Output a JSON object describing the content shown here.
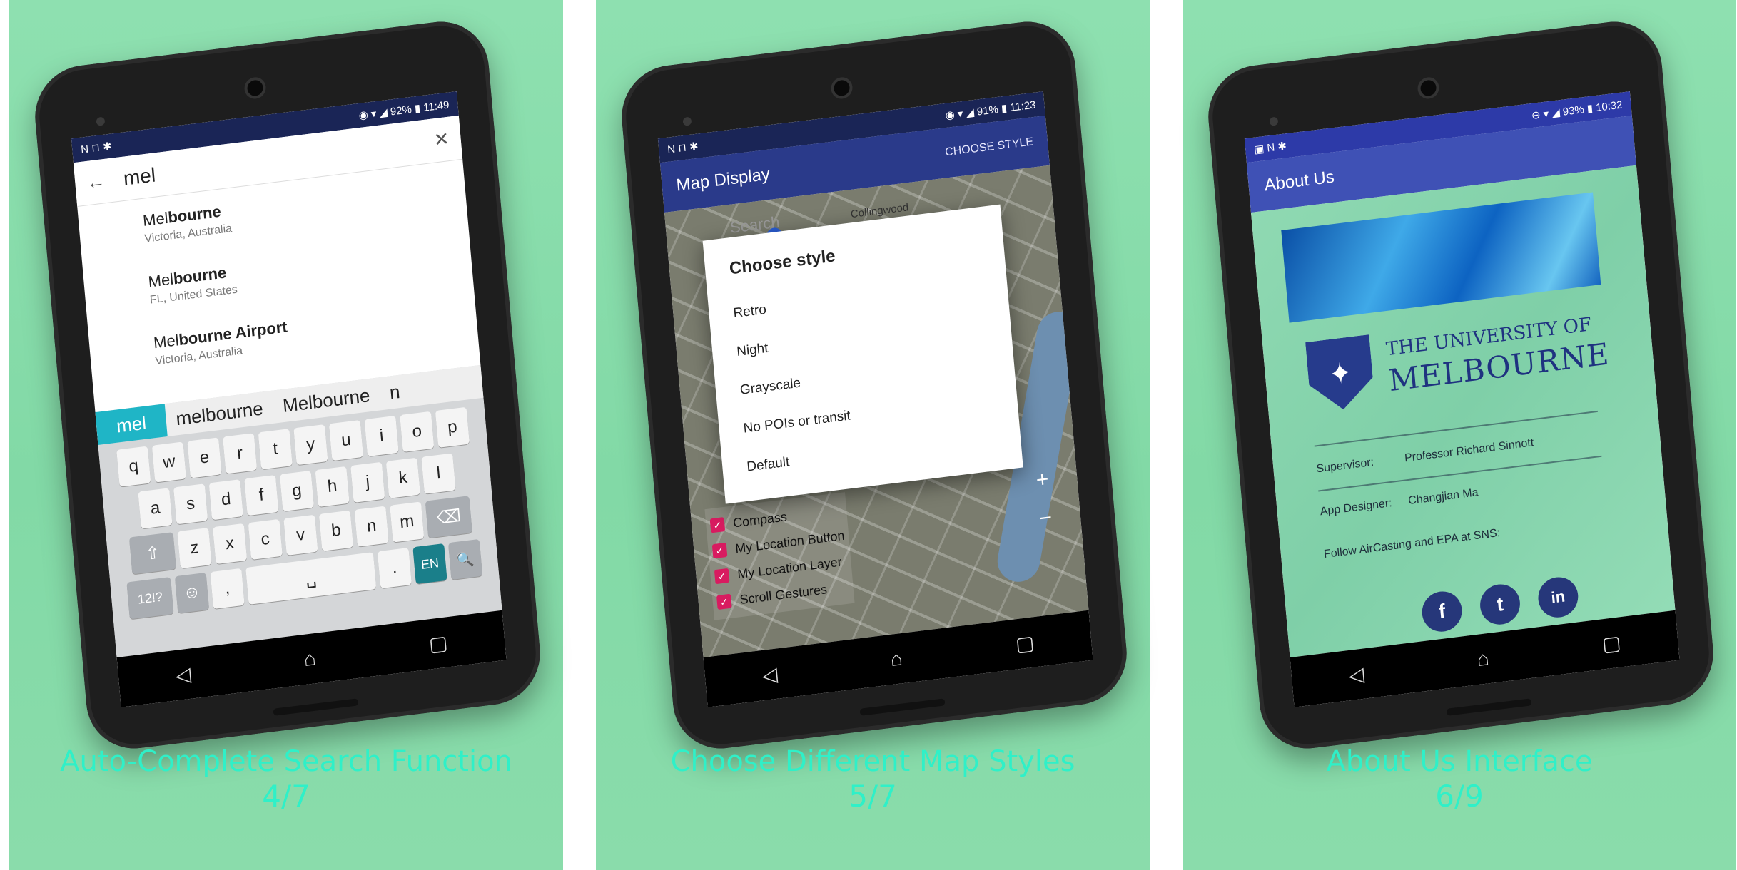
{
  "panels": [
    {
      "caption": "Auto-Complete Search Function",
      "page": "4/7",
      "status": {
        "left": "N ⊓ ✱",
        "right": "◉ ▾ ◢ 92% ▮ 11:49"
      },
      "search": {
        "query": "mel",
        "back_icon": "arrow-left-icon",
        "clear_icon": "close-icon"
      },
      "suggestions": [
        {
          "match": "Mel",
          "rest": "bourne",
          "sub": "Victoria, Australia"
        },
        {
          "match": "Mel",
          "rest": "bourne",
          "sub": "FL, United States"
        },
        {
          "match": "Mel",
          "rest": "bourne Airport",
          "sub": "Victoria, Australia"
        }
      ],
      "keyboard": {
        "predictions": [
          "mel",
          "melbourne",
          "Melbourne",
          "n"
        ],
        "row1": [
          "q",
          "w",
          "e",
          "r",
          "t",
          "y",
          "u",
          "i",
          "o",
          "p"
        ],
        "row2": [
          "a",
          "s",
          "d",
          "f",
          "g",
          "h",
          "j",
          "k",
          "l"
        ],
        "row3": [
          "⇧",
          "z",
          "x",
          "c",
          "v",
          "b",
          "n",
          "m",
          "⌫"
        ],
        "row4": [
          "12!?",
          "☺",
          ",",
          "␣",
          ".",
          "EN",
          "🔍"
        ]
      }
    },
    {
      "caption": "Choose Different Map Styles",
      "page": "5/7",
      "status": {
        "left": "N ⊓ ✱",
        "right": "◉ ▾ ◢ 91% ▮ 11:23"
      },
      "appbar": {
        "title": "Map Display",
        "action": "CHOOSE STYLE"
      },
      "map": {
        "search_placeholder": "Search",
        "place": "Collingwood"
      },
      "dialog": {
        "title": "Choose style",
        "options": [
          "Retro",
          "Night",
          "Grayscale",
          "No POIs or transit",
          "Default"
        ]
      },
      "checks": [
        "Compass",
        "My Location Button",
        "My Location Layer",
        "Scroll Gestures"
      ]
    },
    {
      "caption": "About Us Interface",
      "page": "6/9",
      "status": {
        "left": "▣ N ✱",
        "right": "⊖ ▾ ◢ 93% ▮ 10:32"
      },
      "appbar": {
        "title": "About Us"
      },
      "university": {
        "line1": "THE UNIVERSITY OF",
        "line2": "MELBOURNE"
      },
      "info": [
        {
          "key": "Supervisor:",
          "value": "Professor Richard Sinnott"
        },
        {
          "key": "App Designer:",
          "value": "Changjian Ma"
        }
      ],
      "follow": "Follow AirCasting and EPA at SNS:",
      "social": [
        "f",
        "t",
        "in"
      ]
    }
  ],
  "nav": {
    "back": "◁",
    "home": "⌂",
    "recent": "▢"
  }
}
